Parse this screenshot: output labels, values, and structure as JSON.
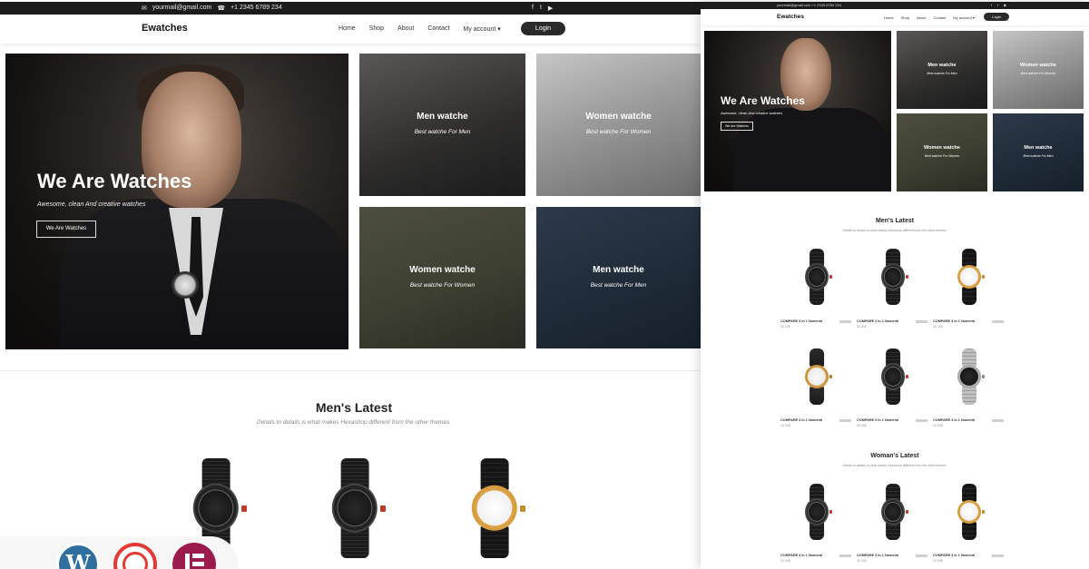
{
  "site": {
    "email": "yourmail@gmail.com",
    "phone": "+1 2345 6789 234",
    "social": [
      "f",
      "t",
      "▶"
    ],
    "logo": "Ewatches",
    "menu": [
      "Home",
      "Shop",
      "About",
      "Contact",
      "My account"
    ],
    "login": "Login"
  },
  "hero": {
    "title": "We Are Watches",
    "subtitle": "Awesome, clean And creative watches",
    "button": "We Are Watches"
  },
  "tiles": [
    {
      "title": "Men watche",
      "subtitle": "Best watche For Men"
    },
    {
      "title": "Women watche",
      "subtitle": "Best watche For Women"
    },
    {
      "title": "Women watche",
      "subtitle": "Best watche For Women"
    },
    {
      "title": "Men watche",
      "subtitle": "Best watche For Men"
    }
  ],
  "mens_latest": {
    "title": "Men's Latest",
    "subtitle": "Details to details is what makes Hexashop different from the other themes."
  },
  "preview": {
    "contact": "yourmail@gmail.com   +1 2345 6789 234",
    "social": [
      "f",
      "t",
      "▶"
    ],
    "logo": "Ewatches",
    "menu": [
      "Home",
      "Shop",
      "About",
      "Contact",
      "My account ▾"
    ],
    "login": "Login",
    "hero": {
      "title": "We Are Watches",
      "subtitle": "Awesome, clean And creative watches",
      "button": "We Are Watches"
    },
    "tiles": [
      {
        "title": "Men watche",
        "subtitle": "Best watche For Men"
      },
      {
        "title": "Women watche",
        "subtitle": "Best watche For Women"
      },
      {
        "title": "Women watche",
        "subtitle": "Best watche For Women"
      },
      {
        "title": "Men watche",
        "subtitle": "Best watche For Men"
      }
    ],
    "mens_latest": {
      "title": "Men's Latest",
      "subtitle": "Details to details is what makes Hexashop different from the other themes."
    },
    "womans_latest": {
      "title": "Woman's Latest",
      "subtitle": "Details to details is what makes Hexashop different from the other themes."
    },
    "products_row1": [
      {
        "name": "COMPARE 3 In 1 Numeral",
        "price": "50.00$"
      },
      {
        "name": "COMPARE 3 In 1 Numeral",
        "price": "50.00$"
      },
      {
        "name": "COMPARE 3 In 1 Numeral",
        "price": "50.00$"
      }
    ],
    "products_row2": [
      {
        "name": "COMPARE 3 In 1 Numeral",
        "price": "10.00$"
      },
      {
        "name": "COMPARE 3 In 1 Numeral",
        "price": "20.00$"
      },
      {
        "name": "COMPARE 3 In 1 Numeral",
        "price": "30.00$"
      }
    ],
    "products_row3": [
      {
        "name": "COMPARE 3 In 1 Numeral",
        "price": "20.00$"
      },
      {
        "name": "COMPARE 3 In 1 Numeral",
        "price": "20.00$"
      },
      {
        "name": "COMPARE 3 In 1 Numeral",
        "price": "50.00$"
      }
    ]
  },
  "badges": {
    "wordpress": "W",
    "icons": [
      "wordpress-icon",
      "revolution-slider-icon",
      "elementor-icon"
    ]
  },
  "colors": {
    "dark": "#1c1c1c",
    "login_bg": "#2a2a2a",
    "wordpress_blue": "#2f6fa0",
    "slider_red": "#e53935",
    "elementor_maroon": "#9b1b4c"
  }
}
